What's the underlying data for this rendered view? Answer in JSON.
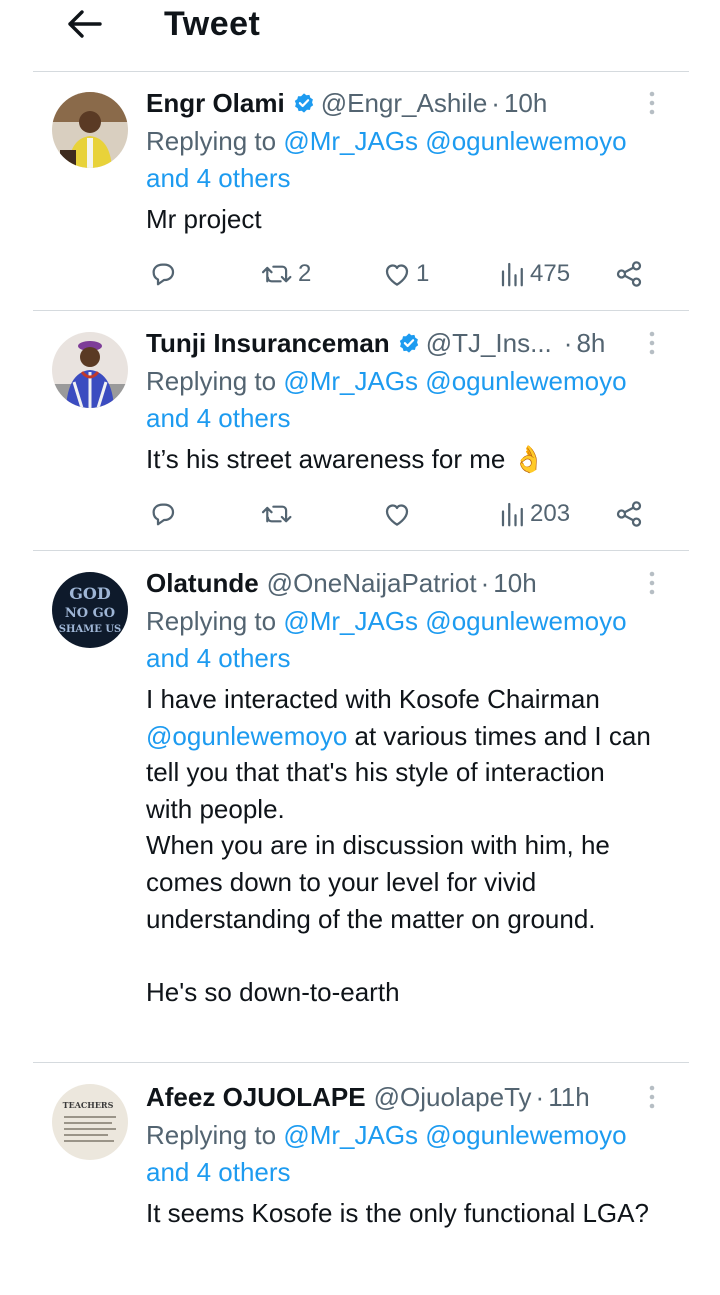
{
  "header": {
    "title": "Tweet",
    "back_icon": "arrow-left-icon"
  },
  "tweets": [
    {
      "name": "Engr Olami",
      "verified": true,
      "handle": "@Engr_Ashile",
      "dot": "·",
      "time": "10h",
      "reply_prefix": "Replying to",
      "reply_mentions": [
        "@Mr_JAGs",
        "@ogunlewemoyo"
      ],
      "reply_others": "and 4 others",
      "text": "Mr project",
      "stats": {
        "replies": "",
        "retweets": "2",
        "likes": "1",
        "views": "475"
      }
    },
    {
      "name": "Tunji Insuranceman",
      "verified": true,
      "handle": "@TJ_Ins...",
      "dot": "·",
      "time": "8h",
      "reply_prefix": "Replying to",
      "reply_mentions": [
        "@Mr_JAGs",
        "@ogunlewemoyo"
      ],
      "reply_others": "and 4 others",
      "text": "It’s his street awareness for me 👌",
      "stats": {
        "replies": "",
        "retweets": "",
        "likes": "",
        "views": "203"
      }
    },
    {
      "name": "Olatunde",
      "verified": false,
      "handle": "@OneNaijaPatriot",
      "dot": "·",
      "time": "10h",
      "reply_prefix": "Replying to",
      "reply_mentions": [
        "@Mr_JAGs",
        "@ogunlewemoyo"
      ],
      "reply_others": "and 4 others",
      "avatar_text": [
        "GOD",
        "NO GO",
        "SHAME US"
      ],
      "text_parts": {
        "p1a": "I have interacted with Kosofe Chairman",
        "mention": "@ogunlewemoyo",
        "p1b": " at various times and I can tell you that that's his style of interaction with people.",
        "p2": "When you are in discussion with him, he comes down to your level for vivid understanding of the matter on ground.",
        "p3": "He's so down-to-earth"
      }
    },
    {
      "name": "Afeez OJUOLAPE",
      "verified": false,
      "handle": "@OjuolapeTy",
      "dot": "·",
      "time": "11h",
      "reply_prefix": "Replying to",
      "reply_mentions": [
        "@Mr_JAGs",
        "@ogunlewemoyo"
      ],
      "reply_others": "and 4 others",
      "avatar_text": "TEACHERS",
      "text": "It seems Kosofe is the only functional LGA?"
    }
  ],
  "icons": {
    "reply": "reply-icon",
    "retweet": "retweet-icon",
    "like": "heart-icon",
    "views": "views-icon",
    "share": "share-icon",
    "more": "more-vertical-icon",
    "verified": "verified-badge-icon"
  },
  "colors": {
    "link": "#1d9bf0",
    "secondary": "#536471",
    "text": "#0f1419",
    "divider": "#d5dade"
  }
}
